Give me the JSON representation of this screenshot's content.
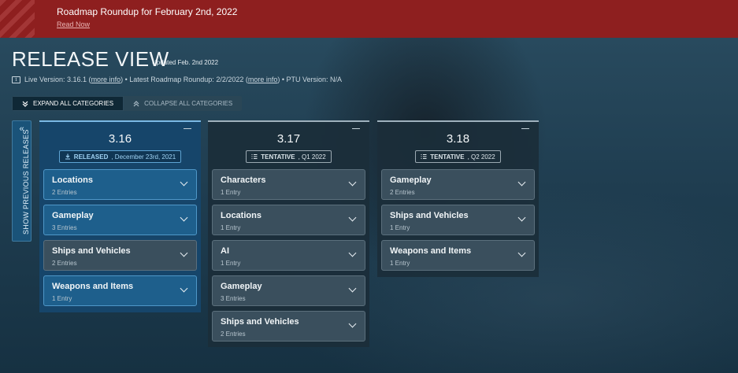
{
  "banner": {
    "title": "Roadmap Roundup for February 2nd, 2022",
    "link": "Read Now"
  },
  "header": {
    "title": "RELEASE VIEW",
    "updated": "Updated Feb. 2nd 2022",
    "info": {
      "live_prefix": "Live Version: 3.16.1 (",
      "live_link": "more info",
      "roadmap_prefix": ") • Latest Roadmap Roundup: 2/2/2022 (",
      "roadmap_link": "more info",
      "ptu_text": ") • PTU Version: N/A"
    }
  },
  "toggle": {
    "expand_label": "EXPAND ALL CATEGORIES",
    "collapse_label": "COLLAPSE ALL CATEGORIES"
  },
  "sidebar": {
    "previous_label": "SHOW PREVIOUS RELEASES"
  },
  "releases": [
    {
      "version": "3.16",
      "status": "RELEASED",
      "date": ", December 23rd, 2021",
      "categories": [
        {
          "name": "Locations",
          "count": "2 Entries"
        },
        {
          "name": "Gameplay",
          "count": "3 Entries"
        },
        {
          "name": "Ships and Vehicles",
          "count": "2 Entries"
        },
        {
          "name": "Weapons and Items",
          "count": "1 Entry"
        }
      ]
    },
    {
      "version": "3.17",
      "status": "TENTATIVE",
      "date": ", Q1 2022",
      "categories": [
        {
          "name": "Characters",
          "count": "1 Entry"
        },
        {
          "name": "Locations",
          "count": "1 Entry"
        },
        {
          "name": "AI",
          "count": "1 Entry"
        },
        {
          "name": "Gameplay",
          "count": "3 Entries"
        },
        {
          "name": "Ships and Vehicles",
          "count": "2 Entries"
        }
      ]
    },
    {
      "version": "3.18",
      "status": "TENTATIVE",
      "date": ", Q2 2022",
      "categories": [
        {
          "name": "Gameplay",
          "count": "2 Entries"
        },
        {
          "name": "Ships and Vehicles",
          "count": "1 Entry"
        },
        {
          "name": "Weapons and Items",
          "count": "1 Entry"
        }
      ]
    }
  ],
  "colors": {
    "banner": "#8e1f1f",
    "current_release": "#16456a",
    "accent": "#7ab9e5"
  }
}
